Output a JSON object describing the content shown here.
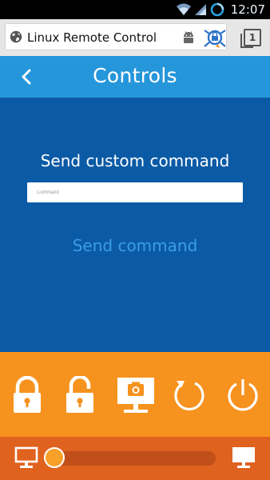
{
  "status_bar": {
    "time": "12:07",
    "icons": [
      "wifi-icon",
      "signal-icon",
      "battery-charging-icon"
    ]
  },
  "browser": {
    "url_title": "Linux Remote Control",
    "tab_count": "1",
    "icons": [
      "globe-icon",
      "android-icon",
      "extension-icon",
      "tabs-icon"
    ]
  },
  "header": {
    "title": "Controls",
    "back_icon": "chevron-left-icon"
  },
  "command": {
    "section_title": "Send custom command",
    "input_value": "",
    "input_placeholder": "Command",
    "send_label": "Send command"
  },
  "actions": [
    {
      "name": "lock",
      "icon": "lock-icon"
    },
    {
      "name": "unlock",
      "icon": "unlock-icon"
    },
    {
      "name": "screenshot",
      "icon": "screen-camera-icon"
    },
    {
      "name": "restart",
      "icon": "restart-icon"
    },
    {
      "name": "power",
      "icon": "power-icon"
    }
  ],
  "brightness": {
    "value_fraction": 0.05,
    "icons": [
      "monitor-off-icon",
      "monitor-on-icon"
    ]
  },
  "colors": {
    "header": "#2696db",
    "main": "#0b5aa6",
    "actions": "#f6921e",
    "bottom": "#e0621f",
    "send_link": "#3a9ee6"
  }
}
